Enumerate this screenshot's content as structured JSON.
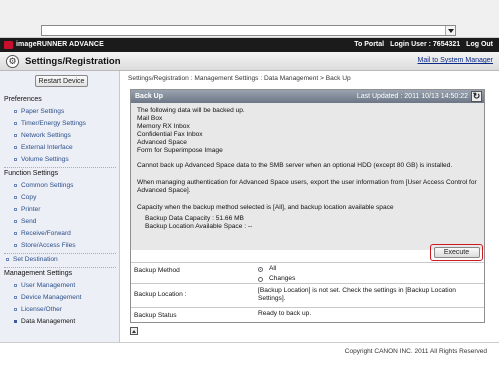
{
  "browser": {
    "url_value": ""
  },
  "topbar": {
    "product": "imageRUNNER ADVANCE",
    "to_portal": "To Portal",
    "login_label": "Login User :",
    "login_user": "7654321",
    "logout": "Log Out"
  },
  "header": {
    "title": "Settings/Registration",
    "mail_link": "Mail to System Manager"
  },
  "sidebar": {
    "restart_label": "Restart Device",
    "sections": [
      {
        "title": "Preferences",
        "items": [
          "Paper Settings",
          "Timer/Energy Settings",
          "Network Settings",
          "External Interface",
          "Volume Settings"
        ]
      },
      {
        "title": "Function Settings",
        "items": [
          "Common Settings",
          "Copy",
          "Printer",
          "Send",
          "Receive/Forward",
          "Store/Access Files"
        ]
      },
      {
        "title": "Set Destination"
      },
      {
        "title": "Management Settings",
        "items": [
          "User Management",
          "Device Management",
          "License/Other",
          "Data Management"
        ]
      }
    ]
  },
  "main": {
    "breadcrumb": "Settings/Registration : Management Settings : Data Management > Back Up",
    "panel_title": "Back Up",
    "last_updated": "Last Updated : 2011 10/13 14:50:22",
    "intro": "The following data will be backed up.",
    "items": [
      "Mail Box",
      "Memory RX Inbox",
      "Confidential Fax Inbox",
      "Advanced Space",
      "Form for Superimpose Image"
    ],
    "notice1": "Cannot back up Advanced Space data to the SMB server when an optional HDD (except 80 GB) is installed.",
    "notice2a": "When managing authentication for Advanced Space users, export the user information from [User Access Control for",
    "notice2b": "Advanced Space].",
    "capacity_note": "Capacity when the backup method selected is [All], and backup location available space",
    "data_capacity": "Backup Data Capacity : 51.66 MB",
    "available_space": "Backup Location Available Space : --",
    "execute": "Execute",
    "rows": {
      "method_label": "Backup Method",
      "method_all": "All",
      "method_changes": "Changes",
      "location_label": "Backup Location :",
      "location_a": "[Backup Location] is not set. Check the settings in [Backup Location",
      "location_b": "Settings].",
      "status_label": "Backup Status",
      "status_value": "Ready to back up."
    }
  },
  "footer": {
    "copyright": "Copyright CANON INC. 2011 All Rights Reserved"
  }
}
